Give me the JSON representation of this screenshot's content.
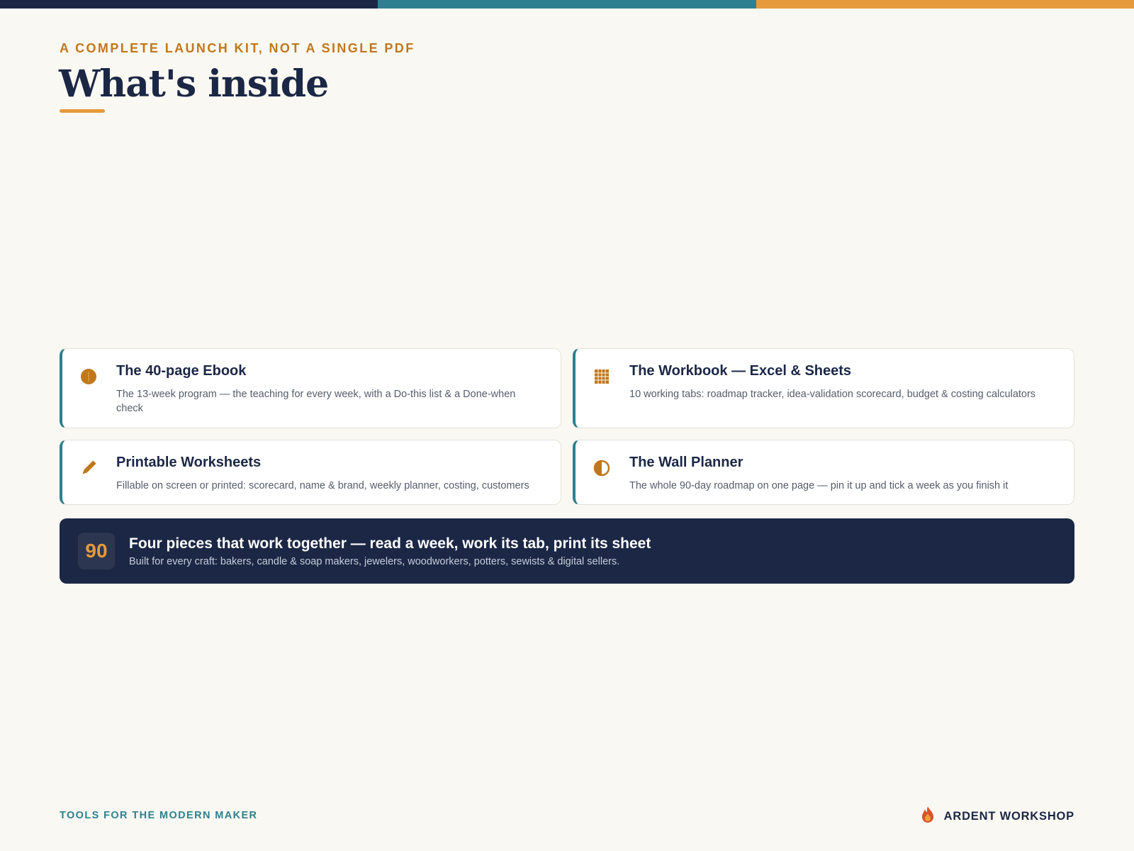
{
  "colors": {
    "navy": "#1b2745",
    "teal": "#2e7f8f",
    "orange": "#e69a3c",
    "amber": "#c0771c",
    "background": "#faf8f2"
  },
  "header": {
    "eyebrow": "A COMPLETE LAUNCH KIT, NOT A SINGLE PDF",
    "title": "What's inside"
  },
  "cards": [
    {
      "icon": "ebook-icon",
      "title": "The 40-page Ebook",
      "description": "The 13-week program — the teaching for every week, with a Do-this list & a Done-when check"
    },
    {
      "icon": "spreadsheet-grid-icon",
      "title": "The Workbook — Excel & Sheets",
      "description": "10 working tabs: roadmap tracker, idea-validation scorecard, budget & costing calculators"
    },
    {
      "icon": "pencil-icon",
      "title": "Printable Worksheets",
      "description": "Fillable on screen or printed: scorecard, name & brand, weekly planner, costing, customers"
    },
    {
      "icon": "half-circle-icon",
      "title": "The Wall Planner",
      "description": "The whole 90-day roadmap on one page — pin it up and tick a week as you finish it"
    }
  ],
  "banner": {
    "badge": "90",
    "title": "Four pieces that work together — read a week, work its tab, print its sheet",
    "subtitle": "Built for every craft: bakers, candle & soap makers, jewelers, woodworkers, potters, sewists & digital sellers."
  },
  "footer": {
    "tagline": "TOOLS FOR THE MODERN MAKER",
    "brand": "ARDENT WORKSHOP",
    "brand_icon": "flame-logo-icon"
  }
}
